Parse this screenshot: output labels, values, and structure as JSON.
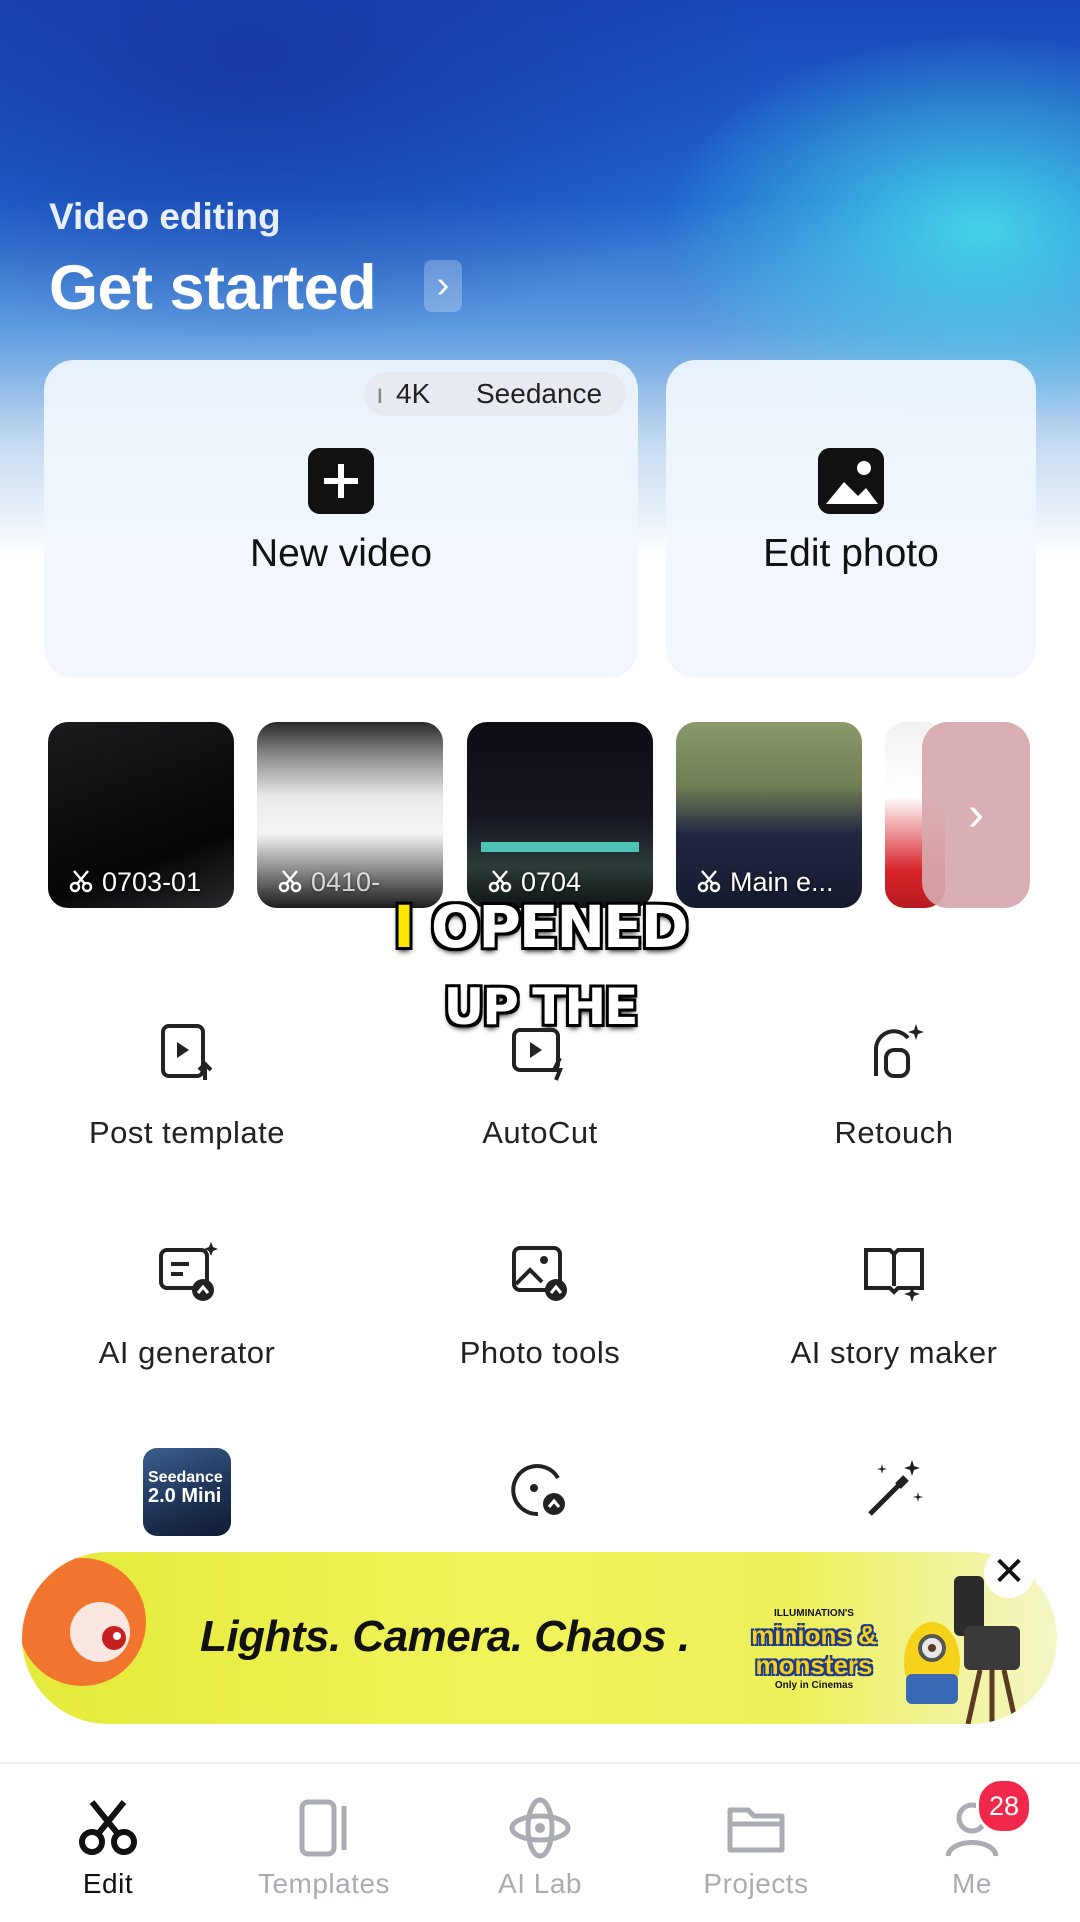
{
  "header": {
    "subtitle": "Video editing",
    "title": "Get started",
    "arrow": "›"
  },
  "cards": {
    "new_video": {
      "label": "New video",
      "pill_left": "4K",
      "pill_right": "Seedance"
    },
    "edit_photo": {
      "label": "Edit photo"
    }
  },
  "recent_projects": [
    {
      "label": "0703-01"
    },
    {
      "label": "0410-"
    },
    {
      "label": "0704"
    },
    {
      "label": "Main e..."
    }
  ],
  "recent_next": "›",
  "caption": {
    "line1_marker": "I",
    "line1": "OPENED",
    "line2": "UP THE"
  },
  "tools": [
    {
      "label": "Post template",
      "icon": "post-template-icon"
    },
    {
      "label": "AutoCut",
      "icon": "autocut-icon"
    },
    {
      "label": "Retouch",
      "icon": "retouch-icon"
    },
    {
      "label": "AI generator",
      "icon": "ai-generator-icon"
    },
    {
      "label": "Photo tools",
      "icon": "photo-tools-icon"
    },
    {
      "label": "AI story maker",
      "icon": "ai-story-maker-icon"
    }
  ],
  "seedance_tile": {
    "line1": "Seedance",
    "line2": "2.0 Mini"
  },
  "ad": {
    "text": "Lights. Camera. Chaos .",
    "brand_top": "ILLUMINATION'S",
    "brand": "minions & monsters",
    "brand_sub": "Only in Cinemas",
    "close": "✕"
  },
  "tabs": [
    {
      "label": "Edit",
      "icon": "scissors-icon",
      "active": true
    },
    {
      "label": "Templates",
      "icon": "templates-icon",
      "active": false
    },
    {
      "label": "AI Lab",
      "icon": "ai-lab-icon",
      "active": false
    },
    {
      "label": "Projects",
      "icon": "folder-icon",
      "active": false
    },
    {
      "label": "Me",
      "icon": "profile-icon",
      "active": false
    }
  ],
  "notifications": {
    "count": "28"
  },
  "colors": {
    "accent_badge": "#f12849",
    "ad_background": "#eef05a",
    "caption_highlight": "#ffe600"
  }
}
